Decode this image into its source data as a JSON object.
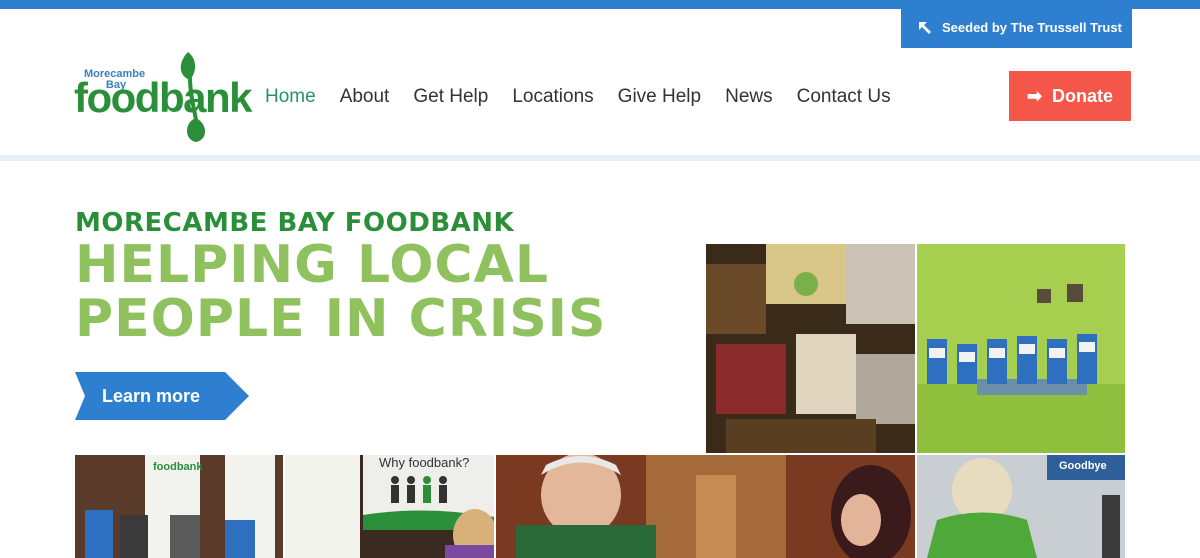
{
  "header": {
    "trussell_label": "Seeded by The Trussell Trust",
    "logo": {
      "line1": "Morecambe",
      "line2": "Bay",
      "word": "foodbank"
    },
    "nav": [
      {
        "label": "Home",
        "active": true
      },
      {
        "label": "About",
        "active": false
      },
      {
        "label": "Get Help",
        "active": false
      },
      {
        "label": "Locations",
        "active": false
      },
      {
        "label": "Give Help",
        "active": false
      },
      {
        "label": "News",
        "active": false
      },
      {
        "label": "Contact Us",
        "active": false
      }
    ],
    "donate_label": "Donate"
  },
  "hero": {
    "kicker": "MORECAMBE BAY FOODBANK",
    "headline_line1": "HELPING LOCAL",
    "headline_line2": "PEOPLE IN CRISIS",
    "cta_label": "Learn more"
  },
  "photos": {
    "why_text": "Why foodbank?",
    "banner_small": "foodbank",
    "goodbye_text": "Goodbye"
  },
  "colors": {
    "brand_blue": "#2f7fd1",
    "brand_green": "#2b8f3a",
    "light_green": "#8fc15e",
    "donate_red": "#f4564a"
  }
}
